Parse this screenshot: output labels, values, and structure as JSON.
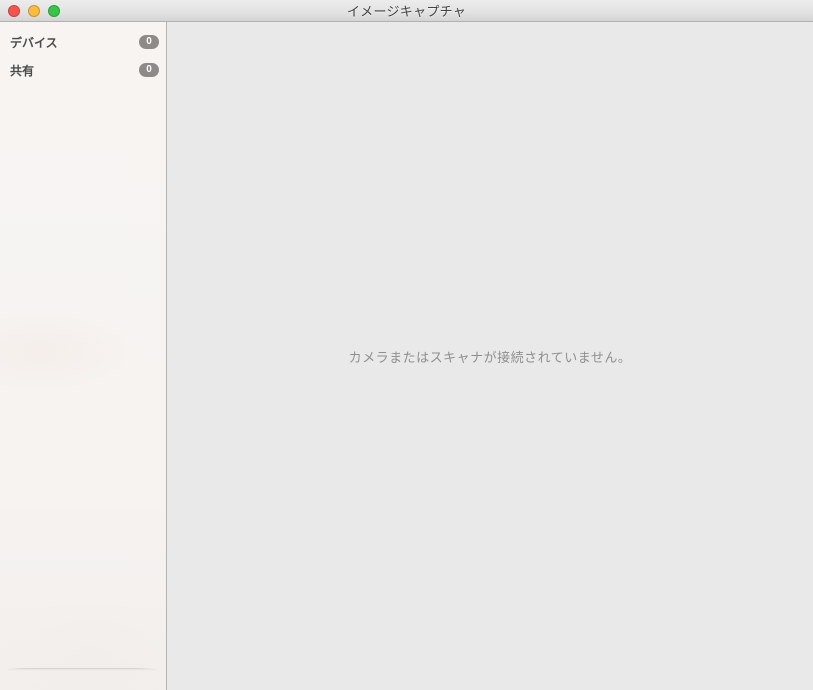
{
  "window": {
    "title": "イメージキャプチャ"
  },
  "titlebar": {
    "close_icon": "close-circle",
    "minimize_icon": "minimize-circle",
    "zoom_icon": "zoom-circle"
  },
  "sidebar": {
    "items": [
      {
        "label": "デバイス",
        "count": "0"
      },
      {
        "label": "共有",
        "count": "0"
      }
    ]
  },
  "main": {
    "empty_message": "カメラまたはスキャナが接続されていません。"
  },
  "colors": {
    "tl_close": "#f7544e",
    "tl_min": "#fcbb40",
    "tl_max": "#35c649",
    "badge_bg": "#8d8a87",
    "main_bg": "#e9e9e9"
  }
}
